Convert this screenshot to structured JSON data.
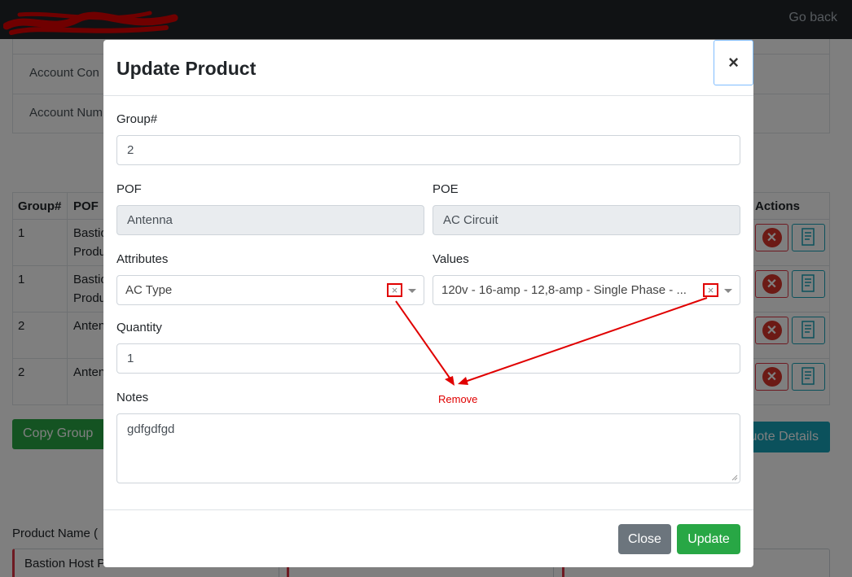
{
  "navbar": {
    "go_back": "Go back"
  },
  "account_card": {
    "rows": [
      "Account Con",
      "Account Num"
    ]
  },
  "product_table": {
    "headers": [
      "Group#",
      "POF",
      "Actions"
    ],
    "rows": [
      {
        "group": "1",
        "pof_line1": "Bastio",
        "pof_line2": "Produ"
      },
      {
        "group": "1",
        "pof_line1": "Bastio",
        "pof_line2": "Produ"
      },
      {
        "group": "2",
        "pof_line1": "Anten",
        "pof_line2": ""
      },
      {
        "group": "2",
        "pof_line1": "Anten",
        "pof_line2": ""
      }
    ]
  },
  "page_buttons": {
    "copy_group": "Copy Group",
    "quote_details": "uote Details"
  },
  "product_section": {
    "label": "Product Name (",
    "field_value": "Bastion Host Product"
  },
  "modal": {
    "title": "Update Product",
    "close_icon": "×",
    "group": {
      "label": "Group#",
      "value": "2"
    },
    "pof": {
      "label": "POF",
      "value": "Antenna"
    },
    "poe": {
      "label": "POE",
      "value": "AC Circuit"
    },
    "attributes": {
      "label": "Attributes",
      "value": "AC Type"
    },
    "values": {
      "label": "Values",
      "value": "120v - 16-amp - 12,8-amp - Single Phase - ..."
    },
    "quantity": {
      "label": "Quantity",
      "value": "1"
    },
    "notes": {
      "label": "Notes",
      "value": "gdfgdfgd"
    },
    "buttons": {
      "close": "Close",
      "update": "Update"
    }
  },
  "annotation": {
    "label": "Remove",
    "color": "#e00000"
  },
  "icons": {
    "clear": "×",
    "delete": "delete-circle-icon",
    "edit": "edit-document-icon"
  },
  "colors": {
    "navbar": "#212529",
    "success": "#28a745",
    "secondary": "#6c757d",
    "info": "#17a2b8",
    "danger": "#dc3545"
  }
}
